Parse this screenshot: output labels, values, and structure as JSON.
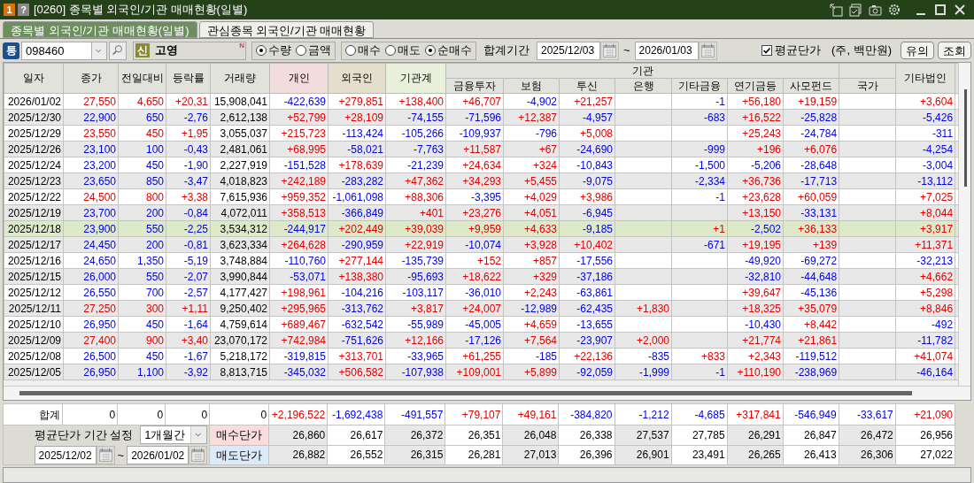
{
  "window": {
    "badges": [
      "1",
      "?"
    ],
    "title": "[0260] 종목별 외국인/기관 매매현황(일별)"
  },
  "tabs": [
    {
      "label": "종목별 외국인/기관 매매현황(일별)",
      "selected": true
    },
    {
      "label": "관심종목 외국인/기관 매매현황",
      "selected": false
    }
  ],
  "toolbar": {
    "market_badge": "통",
    "code": "098460",
    "stock_badge": "신",
    "stock_name": "고영",
    "new_mark": "N",
    "unit_options": [
      {
        "label": "수량",
        "selected": true
      },
      {
        "label": "금액",
        "selected": false
      }
    ],
    "trade_options": [
      {
        "label": "매수",
        "selected": false
      },
      {
        "label": "매도",
        "selected": false
      },
      {
        "label": "순매수",
        "selected": true
      }
    ],
    "period_label": "합계기간",
    "from": "2025/12/03",
    "tilde": "~",
    "to": "2026/01/03",
    "avg_price": {
      "label": "평균단가",
      "checked": true
    },
    "unit_note": "(주, 백만원)",
    "buttons": [
      "유의",
      "조회"
    ]
  },
  "table": {
    "group_label": "기관",
    "columns": [
      {
        "label": "일자",
        "kind": "full"
      },
      {
        "label": "종가",
        "kind": "full"
      },
      {
        "label": "전일대비",
        "kind": "full"
      },
      {
        "label": "등락률",
        "kind": "full"
      },
      {
        "label": "거래량",
        "kind": "full"
      },
      {
        "label": "개인",
        "kind": "full",
        "color": "#f3dcdc"
      },
      {
        "label": "외국인",
        "kind": "full",
        "color": "#e3dfcc"
      },
      {
        "label": "기관계",
        "kind": "full",
        "color": "#e9f1dd"
      },
      {
        "label": "금융투자",
        "kind": "group"
      },
      {
        "label": "보험",
        "kind": "group"
      },
      {
        "label": "투신",
        "kind": "group"
      },
      {
        "label": "은행",
        "kind": "group"
      },
      {
        "label": "기타금융",
        "kind": "group"
      },
      {
        "label": "연기금등",
        "kind": "group"
      },
      {
        "label": "사모펀드",
        "kind": "group"
      },
      {
        "label": "국가",
        "kind": "lower"
      },
      {
        "label": "기타법인",
        "kind": "full"
      }
    ],
    "rows": [
      {
        "date": "2026/01/02",
        "close": "27,550",
        "change": "4,650",
        "rate": "+20,31",
        "volume": "15,908,041",
        "up": true,
        "selected": false,
        "flows": [
          {
            "kind": "number",
            "text": "-422,639"
          },
          {
            "kind": "number",
            "text": "+279,851"
          },
          {
            "kind": "number",
            "text": "+138,400"
          },
          {
            "kind": "number",
            "text": "+46,707"
          },
          {
            "kind": "number",
            "text": "-4,902"
          },
          {
            "kind": "number",
            "text": "+21,257"
          },
          {
            "kind": "empty"
          },
          {
            "kind": "number",
            "text": "-1"
          },
          {
            "kind": "number",
            "text": "+56,180"
          },
          {
            "kind": "number",
            "text": "+19,159"
          },
          {
            "kind": "empty"
          },
          {
            "kind": "number",
            "text": "+3,604"
          }
        ]
      },
      {
        "date": "2025/12/30",
        "close": "22,900",
        "change": "650",
        "rate": "-2,76",
        "volume": "2,612,138",
        "up": false,
        "selected": false,
        "flows": [
          {
            "kind": "number",
            "text": "+52,799"
          },
          {
            "kind": "number",
            "text": "+28,109"
          },
          {
            "kind": "number",
            "text": "-74,155"
          },
          {
            "kind": "number",
            "text": "-71,596"
          },
          {
            "kind": "number",
            "text": "+12,387"
          },
          {
            "kind": "number",
            "text": "-4,957"
          },
          {
            "kind": "empty"
          },
          {
            "kind": "number",
            "text": "-683"
          },
          {
            "kind": "number",
            "text": "+16,522"
          },
          {
            "kind": "number",
            "text": "-25,828"
          },
          {
            "kind": "empty"
          },
          {
            "kind": "number",
            "text": "-5,426"
          }
        ]
      },
      {
        "date": "2025/12/29",
        "close": "23,550",
        "change": "450",
        "rate": "+1,95",
        "volume": "3,055,037",
        "up": true,
        "selected": false,
        "flows": [
          {
            "kind": "number",
            "text": "+215,723"
          },
          {
            "kind": "number",
            "text": "-113,424"
          },
          {
            "kind": "number",
            "text": "-105,266"
          },
          {
            "kind": "number",
            "text": "-109,937"
          },
          {
            "kind": "number",
            "text": "-796"
          },
          {
            "kind": "number",
            "text": "+5,008"
          },
          {
            "kind": "empty"
          },
          {
            "kind": "empty"
          },
          {
            "kind": "number",
            "text": "+25,243"
          },
          {
            "kind": "number",
            "text": "-24,784"
          },
          {
            "kind": "empty"
          },
          {
            "kind": "number",
            "text": "-311"
          }
        ]
      },
      {
        "date": "2025/12/26",
        "close": "23,100",
        "change": "100",
        "rate": "-0,43",
        "volume": "2,481,061",
        "up": false,
        "selected": false,
        "flows": [
          {
            "kind": "number",
            "text": "+68,995"
          },
          {
            "kind": "number",
            "text": "-58,021"
          },
          {
            "kind": "number",
            "text": "-7,763"
          },
          {
            "kind": "number",
            "text": "+11,587"
          },
          {
            "kind": "number",
            "text": "+67"
          },
          {
            "kind": "number",
            "text": "-24,690"
          },
          {
            "kind": "empty"
          },
          {
            "kind": "number",
            "text": "-999"
          },
          {
            "kind": "number",
            "text": "+196"
          },
          {
            "kind": "number",
            "text": "+6,076"
          },
          {
            "kind": "empty"
          },
          {
            "kind": "number",
            "text": "-4,254"
          }
        ]
      },
      {
        "date": "2025/12/24",
        "close": "23,200",
        "change": "450",
        "rate": "-1,90",
        "volume": "2,227,919",
        "up": false,
        "selected": false,
        "flows": [
          {
            "kind": "number",
            "text": "-151,528"
          },
          {
            "kind": "number",
            "text": "+178,639"
          },
          {
            "kind": "number",
            "text": "-21,239"
          },
          {
            "kind": "number",
            "text": "+24,634"
          },
          {
            "kind": "number",
            "text": "+324"
          },
          {
            "kind": "number",
            "text": "-10,843"
          },
          {
            "kind": "empty"
          },
          {
            "kind": "number",
            "text": "-1,500"
          },
          {
            "kind": "number",
            "text": "-5,206"
          },
          {
            "kind": "number",
            "text": "-28,648"
          },
          {
            "kind": "empty"
          },
          {
            "kind": "number",
            "text": "-3,004"
          }
        ]
      },
      {
        "date": "2025/12/23",
        "close": "23,650",
        "change": "850",
        "rate": "-3,47",
        "volume": "4,018,823",
        "up": false,
        "selected": false,
        "flows": [
          {
            "kind": "number",
            "text": "+242,189"
          },
          {
            "kind": "number",
            "text": "-283,282"
          },
          {
            "kind": "number",
            "text": "+47,362"
          },
          {
            "kind": "number",
            "text": "+34,293"
          },
          {
            "kind": "number",
            "text": "+5,455"
          },
          {
            "kind": "number",
            "text": "-9,075"
          },
          {
            "kind": "empty"
          },
          {
            "kind": "number",
            "text": "-2,334"
          },
          {
            "kind": "number",
            "text": "+36,736"
          },
          {
            "kind": "number",
            "text": "-17,713"
          },
          {
            "kind": "empty"
          },
          {
            "kind": "number",
            "text": "-13,112"
          }
        ]
      },
      {
        "date": "2025/12/22",
        "close": "24,500",
        "change": "800",
        "rate": "+3,38",
        "volume": "7,615,936",
        "up": true,
        "selected": false,
        "flows": [
          {
            "kind": "number",
            "text": "+959,352"
          },
          {
            "kind": "number",
            "text": "-1,061,098"
          },
          {
            "kind": "number",
            "text": "+88,306"
          },
          {
            "kind": "number",
            "text": "-3,395"
          },
          {
            "kind": "number",
            "text": "+4,029"
          },
          {
            "kind": "number",
            "text": "+3,986"
          },
          {
            "kind": "empty"
          },
          {
            "kind": "number",
            "text": "-1"
          },
          {
            "kind": "number",
            "text": "+23,628"
          },
          {
            "kind": "number",
            "text": "+60,059"
          },
          {
            "kind": "empty"
          },
          {
            "kind": "number",
            "text": "+7,025"
          }
        ]
      },
      {
        "date": "2025/12/19",
        "close": "23,700",
        "change": "200",
        "rate": "-0,84",
        "volume": "4,072,011",
        "up": false,
        "selected": false,
        "flows": [
          {
            "kind": "number",
            "text": "+358,513"
          },
          {
            "kind": "number",
            "text": "-366,849"
          },
          {
            "kind": "number",
            "text": "+401"
          },
          {
            "kind": "number",
            "text": "+23,276"
          },
          {
            "kind": "number",
            "text": "+4,051"
          },
          {
            "kind": "number",
            "text": "-6,945"
          },
          {
            "kind": "empty"
          },
          {
            "kind": "empty"
          },
          {
            "kind": "number",
            "text": "+13,150"
          },
          {
            "kind": "number",
            "text": "-33,131"
          },
          {
            "kind": "empty"
          },
          {
            "kind": "number",
            "text": "+8,044"
          }
        ]
      },
      {
        "date": "2025/12/18",
        "close": "23,900",
        "change": "550",
        "rate": "-2,25",
        "volume": "3,534,312",
        "up": false,
        "selected": true,
        "flows": [
          {
            "kind": "number",
            "text": "-244,917"
          },
          {
            "kind": "number",
            "text": "+202,449"
          },
          {
            "kind": "number",
            "text": "+39,039"
          },
          {
            "kind": "number",
            "text": "+9,959"
          },
          {
            "kind": "number",
            "text": "+4,633"
          },
          {
            "kind": "number",
            "text": "-9,185"
          },
          {
            "kind": "empty"
          },
          {
            "kind": "number",
            "text": "+1"
          },
          {
            "kind": "number",
            "text": "-2,502"
          },
          {
            "kind": "number",
            "text": "+36,133"
          },
          {
            "kind": "empty"
          },
          {
            "kind": "number",
            "text": "+3,917"
          }
        ]
      },
      {
        "date": "2025/12/17",
        "close": "24,450",
        "change": "200",
        "rate": "-0,81",
        "volume": "3,623,334",
        "up": false,
        "selected": false,
        "flows": [
          {
            "kind": "number",
            "text": "+264,628"
          },
          {
            "kind": "number",
            "text": "-290,959"
          },
          {
            "kind": "number",
            "text": "+22,919"
          },
          {
            "kind": "number",
            "text": "-10,074"
          },
          {
            "kind": "number",
            "text": "+3,928"
          },
          {
            "kind": "number",
            "text": "+10,402"
          },
          {
            "kind": "empty"
          },
          {
            "kind": "number",
            "text": "-671"
          },
          {
            "kind": "number",
            "text": "+19,195"
          },
          {
            "kind": "number",
            "text": "+139"
          },
          {
            "kind": "empty"
          },
          {
            "kind": "number",
            "text": "+11,371"
          }
        ]
      },
      {
        "date": "2025/12/16",
        "close": "24,650",
        "change": "1,350",
        "rate": "-5,19",
        "volume": "3,748,884",
        "up": false,
        "selected": false,
        "flows": [
          {
            "kind": "number",
            "text": "-110,760"
          },
          {
            "kind": "number",
            "text": "+277,144"
          },
          {
            "kind": "number",
            "text": "-135,739"
          },
          {
            "kind": "number",
            "text": "+152"
          },
          {
            "kind": "number",
            "text": "+857"
          },
          {
            "kind": "number",
            "text": "-17,556"
          },
          {
            "kind": "empty"
          },
          {
            "kind": "empty"
          },
          {
            "kind": "number",
            "text": "-49,920"
          },
          {
            "kind": "number",
            "text": "-69,272"
          },
          {
            "kind": "empty"
          },
          {
            "kind": "number",
            "text": "-32,213"
          }
        ]
      },
      {
        "date": "2025/12/15",
        "close": "26,000",
        "change": "550",
        "rate": "-2,07",
        "volume": "3,990,844",
        "up": false,
        "selected": false,
        "flows": [
          {
            "kind": "number",
            "text": "-53,071"
          },
          {
            "kind": "number",
            "text": "+138,380"
          },
          {
            "kind": "number",
            "text": "-95,693"
          },
          {
            "kind": "number",
            "text": "+18,622"
          },
          {
            "kind": "number",
            "text": "+329"
          },
          {
            "kind": "number",
            "text": "-37,186"
          },
          {
            "kind": "empty"
          },
          {
            "kind": "empty"
          },
          {
            "kind": "number",
            "text": "-32,810"
          },
          {
            "kind": "number",
            "text": "-44,648"
          },
          {
            "kind": "empty"
          },
          {
            "kind": "number",
            "text": "+4,662"
          }
        ]
      },
      {
        "date": "2025/12/12",
        "close": "26,550",
        "change": "700",
        "rate": "-2,57",
        "volume": "4,177,427",
        "up": false,
        "selected": false,
        "flows": [
          {
            "kind": "number",
            "text": "+198,961"
          },
          {
            "kind": "number",
            "text": "-104,216"
          },
          {
            "kind": "number",
            "text": "-103,117"
          },
          {
            "kind": "number",
            "text": "-36,010"
          },
          {
            "kind": "number",
            "text": "+2,243"
          },
          {
            "kind": "number",
            "text": "-63,861"
          },
          {
            "kind": "empty"
          },
          {
            "kind": "empty"
          },
          {
            "kind": "number",
            "text": "+39,647"
          },
          {
            "kind": "number",
            "text": "-45,136"
          },
          {
            "kind": "empty"
          },
          {
            "kind": "number",
            "text": "+5,298"
          }
        ]
      },
      {
        "date": "2025/12/11",
        "close": "27,250",
        "change": "300",
        "rate": "+1,11",
        "volume": "9,250,402",
        "up": true,
        "selected": false,
        "flows": [
          {
            "kind": "number",
            "text": "+295,965"
          },
          {
            "kind": "number",
            "text": "-313,762"
          },
          {
            "kind": "number",
            "text": "+3,817"
          },
          {
            "kind": "number",
            "text": "+24,007"
          },
          {
            "kind": "number",
            "text": "-12,989"
          },
          {
            "kind": "number",
            "text": "-62,435"
          },
          {
            "kind": "number",
            "text": "+1,830"
          },
          {
            "kind": "empty"
          },
          {
            "kind": "number",
            "text": "+18,325"
          },
          {
            "kind": "number",
            "text": "+35,079"
          },
          {
            "kind": "empty"
          },
          {
            "kind": "number",
            "text": "+8,846"
          }
        ]
      },
      {
        "date": "2025/12/10",
        "close": "26,950",
        "change": "450",
        "rate": "-1,64",
        "volume": "4,759,614",
        "up": false,
        "selected": false,
        "flows": [
          {
            "kind": "number",
            "text": "+689,467"
          },
          {
            "kind": "number",
            "text": "-632,542"
          },
          {
            "kind": "number",
            "text": "-55,989"
          },
          {
            "kind": "number",
            "text": "-45,005"
          },
          {
            "kind": "number",
            "text": "+4,659"
          },
          {
            "kind": "number",
            "text": "-13,655"
          },
          {
            "kind": "empty"
          },
          {
            "kind": "empty"
          },
          {
            "kind": "number",
            "text": "-10,430"
          },
          {
            "kind": "number",
            "text": "+8,442"
          },
          {
            "kind": "empty"
          },
          {
            "kind": "number",
            "text": "-492"
          }
        ]
      },
      {
        "date": "2025/12/09",
        "close": "27,400",
        "change": "900",
        "rate": "+3,40",
        "volume": "23,070,172",
        "up": true,
        "selected": false,
        "flows": [
          {
            "kind": "number",
            "text": "+742,984"
          },
          {
            "kind": "number",
            "text": "-751,626"
          },
          {
            "kind": "number",
            "text": "+12,166"
          },
          {
            "kind": "number",
            "text": "-17,126"
          },
          {
            "kind": "number",
            "text": "+7,564"
          },
          {
            "kind": "number",
            "text": "-23,907"
          },
          {
            "kind": "number",
            "text": "+2,000"
          },
          {
            "kind": "empty"
          },
          {
            "kind": "number",
            "text": "+21,774"
          },
          {
            "kind": "number",
            "text": "+21,861"
          },
          {
            "kind": "empty"
          },
          {
            "kind": "number",
            "text": "-11,782"
          }
        ]
      },
      {
        "date": "2025/12/08",
        "close": "26,500",
        "change": "450",
        "rate": "-1,67",
        "volume": "5,218,172",
        "up": false,
        "selected": false,
        "flows": [
          {
            "kind": "number",
            "text": "-319,815"
          },
          {
            "kind": "number",
            "text": "+313,701"
          },
          {
            "kind": "number",
            "text": "-33,965"
          },
          {
            "kind": "number",
            "text": "+61,255"
          },
          {
            "kind": "number",
            "text": "-185"
          },
          {
            "kind": "number",
            "text": "+22,136"
          },
          {
            "kind": "number",
            "text": "-835"
          },
          {
            "kind": "number",
            "text": "+833"
          },
          {
            "kind": "number",
            "text": "+2,343"
          },
          {
            "kind": "number",
            "text": "-119,512"
          },
          {
            "kind": "empty"
          },
          {
            "kind": "number",
            "text": "+41,074"
          }
        ]
      },
      {
        "date": "2025/12/05",
        "close": "26,950",
        "change": "1,100",
        "rate": "-3,92",
        "volume": "8,813,715",
        "up": false,
        "selected": false,
        "flows": [
          {
            "kind": "number",
            "text": "-345,032"
          },
          {
            "kind": "number",
            "text": "+506,582"
          },
          {
            "kind": "number",
            "text": "-107,938"
          },
          {
            "kind": "number",
            "text": "+109,001"
          },
          {
            "kind": "number",
            "text": "+5,899"
          },
          {
            "kind": "number",
            "text": "-92,059"
          },
          {
            "kind": "number",
            "text": "-1,999"
          },
          {
            "kind": "number",
            "text": "-1"
          },
          {
            "kind": "number",
            "text": "+110,190"
          },
          {
            "kind": "number",
            "text": "-238,969"
          },
          {
            "kind": "empty"
          },
          {
            "kind": "number",
            "text": "-46,164"
          }
        ]
      }
    ],
    "totals": {
      "label": "합계",
      "values": [
        "0",
        "0",
        "0",
        "0",
        "+2,196,522",
        "-1,692,438",
        "-491,557",
        "+79,107",
        "+49,161",
        "-384,820",
        "-1,212",
        "-4,685",
        "+317,841",
        "-546,949",
        "-33,617",
        "+21,090"
      ]
    }
  },
  "avg_price": {
    "period_label": "평균단가 기간 설정",
    "period": "1개월간",
    "from": "2025/12/02",
    "tilde": "~",
    "to": "2026/01/02",
    "buy": {
      "label": "매수단가",
      "values": [
        "26,860",
        "26,617",
        "26,372",
        "26,351",
        "26,048",
        "26,338",
        "27,537",
        "27,785",
        "26,291",
        "26,847",
        "26,472",
        "26,956"
      ]
    },
    "sell": {
      "label": "매도단가",
      "values": [
        "26,882",
        "26,552",
        "26,315",
        "26,281",
        "27,013",
        "26,396",
        "26,901",
        "23,491",
        "26,265",
        "26,413",
        "26,306",
        "27,022"
      ]
    }
  }
}
